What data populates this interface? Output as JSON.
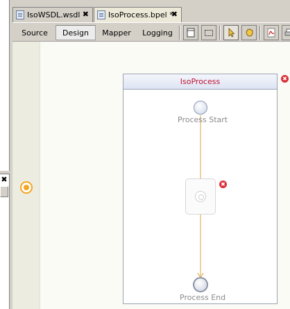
{
  "tabs": [
    {
      "label": "IsoWSDL.wsdl",
      "close": "✖"
    },
    {
      "label": "IsoProcess.bpel *",
      "close": "✖"
    }
  ],
  "toolbar": {
    "views": [
      {
        "label": "Source"
      },
      {
        "label": "Design"
      },
      {
        "label": "Mapper"
      },
      {
        "label": "Logging"
      }
    ]
  },
  "left_panel": {
    "close": "✖"
  },
  "process": {
    "name": "IsoProcess",
    "start_label": "Process Start",
    "end_label": "Process End"
  },
  "error_mark": "✖",
  "colors": {
    "process_title": "#c01030",
    "connector": "#d8a040",
    "anchor": "#f5a623",
    "error": "#d9303a"
  }
}
